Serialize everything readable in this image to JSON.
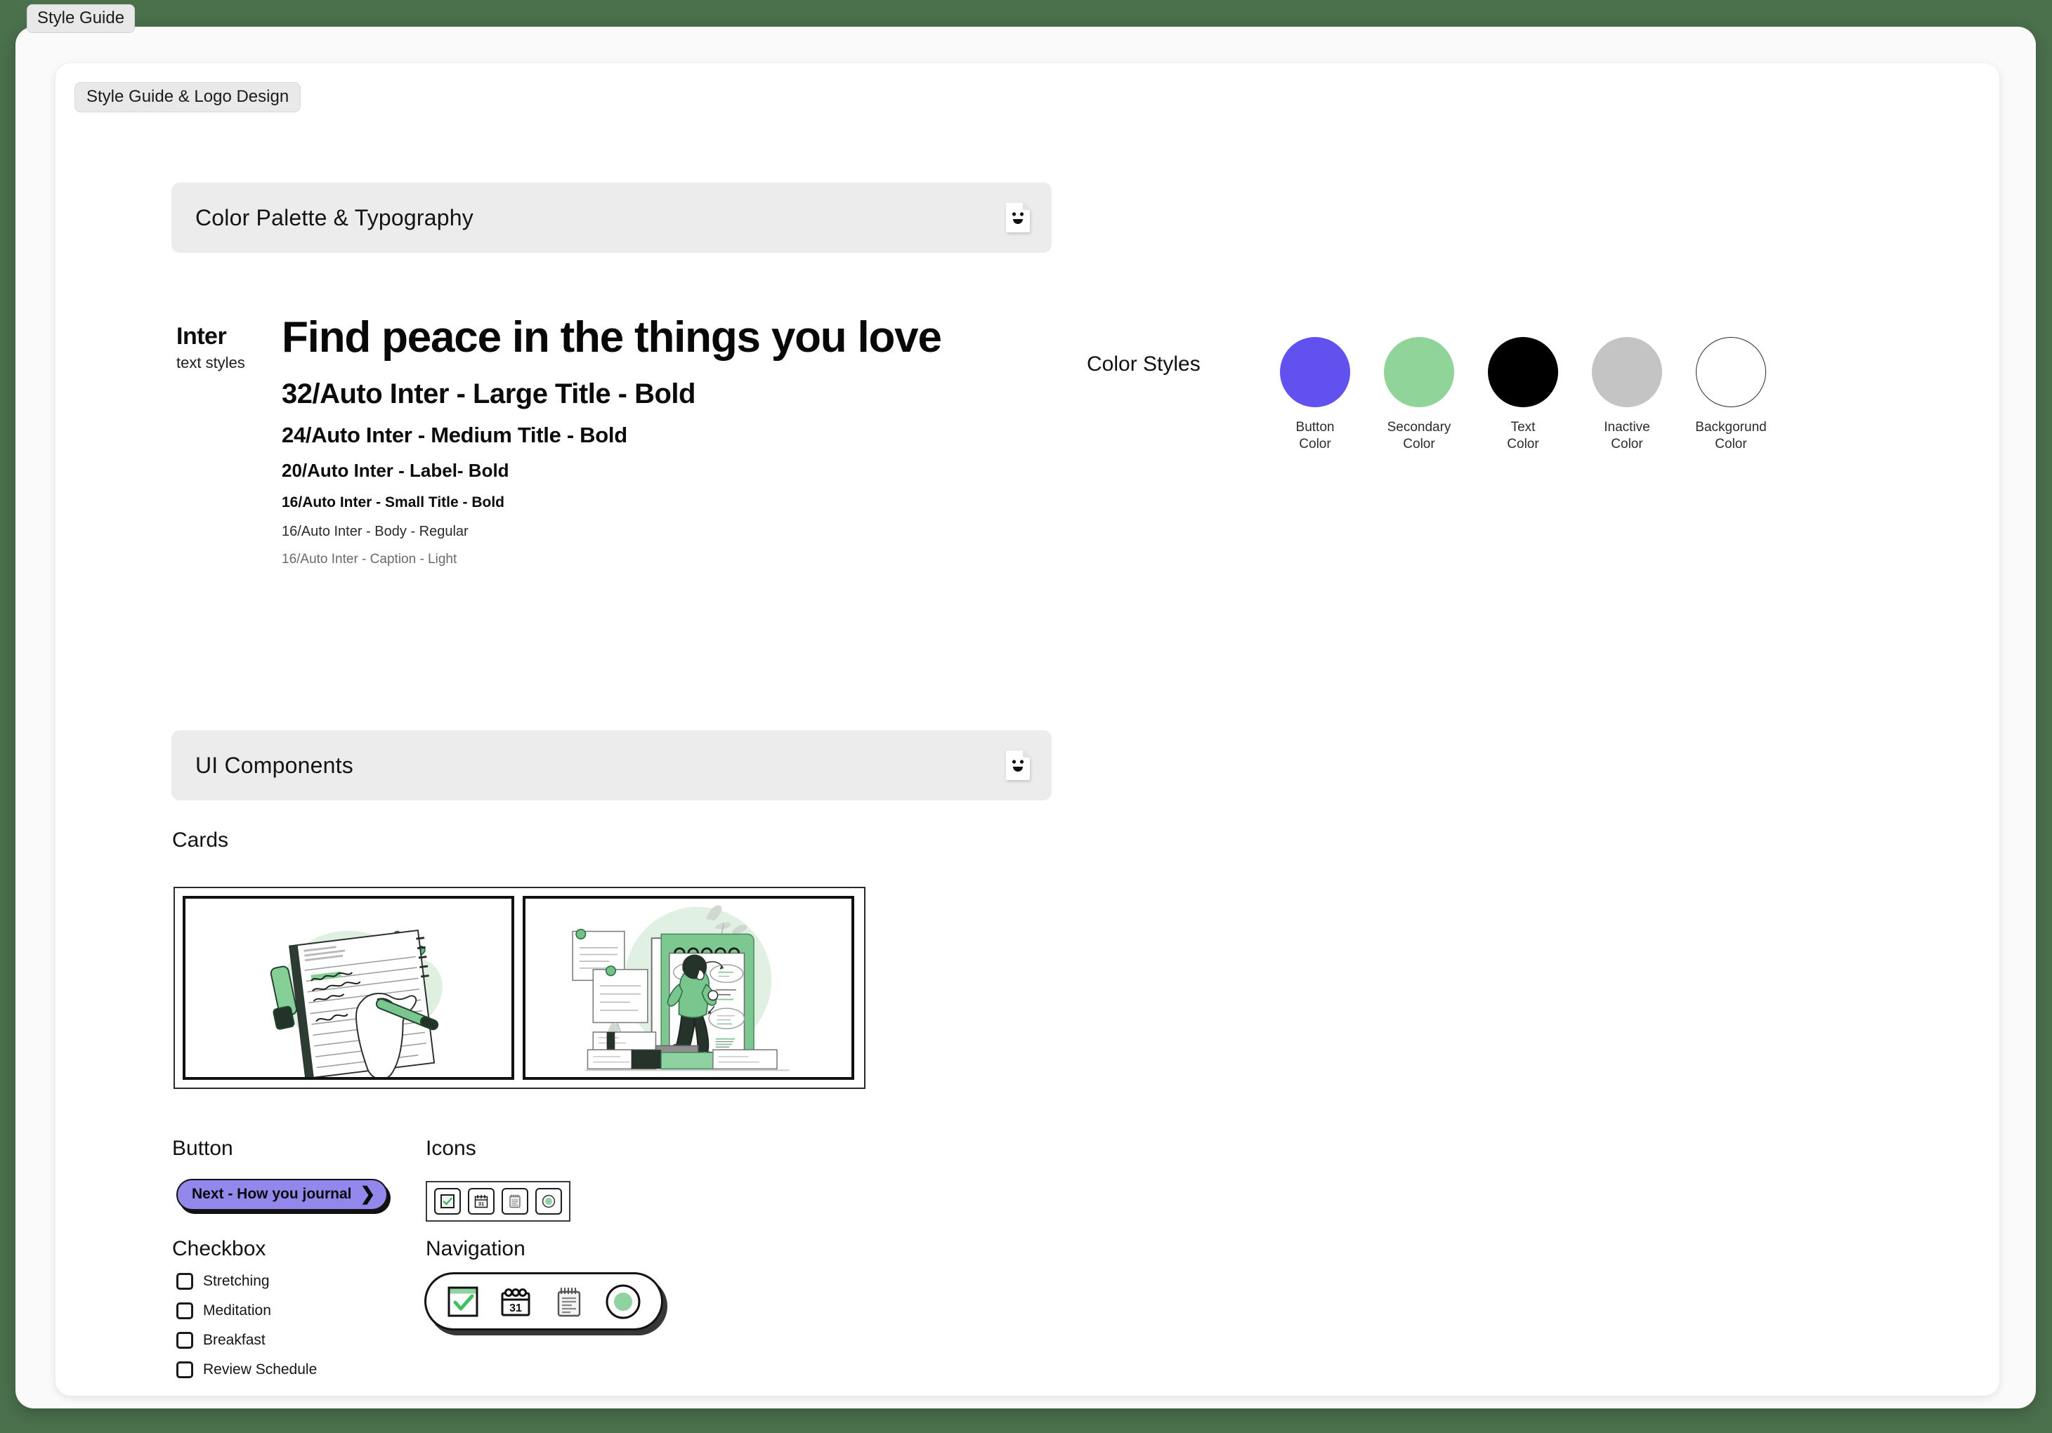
{
  "window": {
    "tab_label": "Style Guide",
    "page_chip_label": "Style Guide & Logo Design",
    "background_color": "#4b704c"
  },
  "sections": {
    "color_typography": {
      "title": "Color Palette & Typography",
      "icon": "document-smiley-icon"
    },
    "ui_components": {
      "title": "UI Components",
      "icon": "document-smiley-icon"
    }
  },
  "typography": {
    "family_name": "Inter",
    "family_sub": "text styles",
    "specimen": "Find peace in the things you love",
    "styles": [
      "32/Auto Inter - Large Title - Bold",
      "24/Auto Inter - Medium Title - Bold",
      "20/Auto Inter - Label- Bold",
      "16/Auto Inter - Small Title - Bold",
      "16/Auto Inter - Body - Regular",
      "16/Auto Inter - Caption - Light"
    ]
  },
  "color_styles": {
    "label": "Color Styles",
    "swatches": [
      {
        "name": "Button\nColor",
        "hex": "#6152f0",
        "border": "none"
      },
      {
        "name": "Secondary\nColor",
        "hex": "#90d49a",
        "border": "none"
      },
      {
        "name": "Text\nColor",
        "hex": "#000000",
        "border": "none"
      },
      {
        "name": "Inactive\nColor",
        "hex": "#c4c4c4",
        "border": "none"
      },
      {
        "name": "Backgorund\nColor",
        "hex": "#ffffff",
        "border": "1px solid #2b2b2b"
      }
    ]
  },
  "components": {
    "cards_label": "Cards",
    "cards": [
      {
        "alt": "hand-writing-in-notebook-illustration"
      },
      {
        "alt": "person-writing-on-giant-notepad-illustration"
      }
    ],
    "button_label": "Button",
    "button": {
      "text": "Next - How you journal",
      "chevron": "❯",
      "fill": "#9287ea"
    },
    "icons_label": "Icons",
    "icons": [
      "checkbox-checked-icon",
      "calendar-31-icon",
      "notepad-icon",
      "circle-dot-icon"
    ],
    "checkbox_label": "Checkbox",
    "checkboxes": [
      {
        "label": "Stretching",
        "checked": false
      },
      {
        "label": "Meditation",
        "checked": false
      },
      {
        "label": "Breakfast",
        "checked": false
      },
      {
        "label": "Review Schedule",
        "checked": false
      }
    ],
    "navigation_label": "Navigation",
    "navigation": [
      "checkbox-checked-icon",
      "calendar-31-icon",
      "notepad-icon",
      "circle-dot-icon"
    ]
  }
}
